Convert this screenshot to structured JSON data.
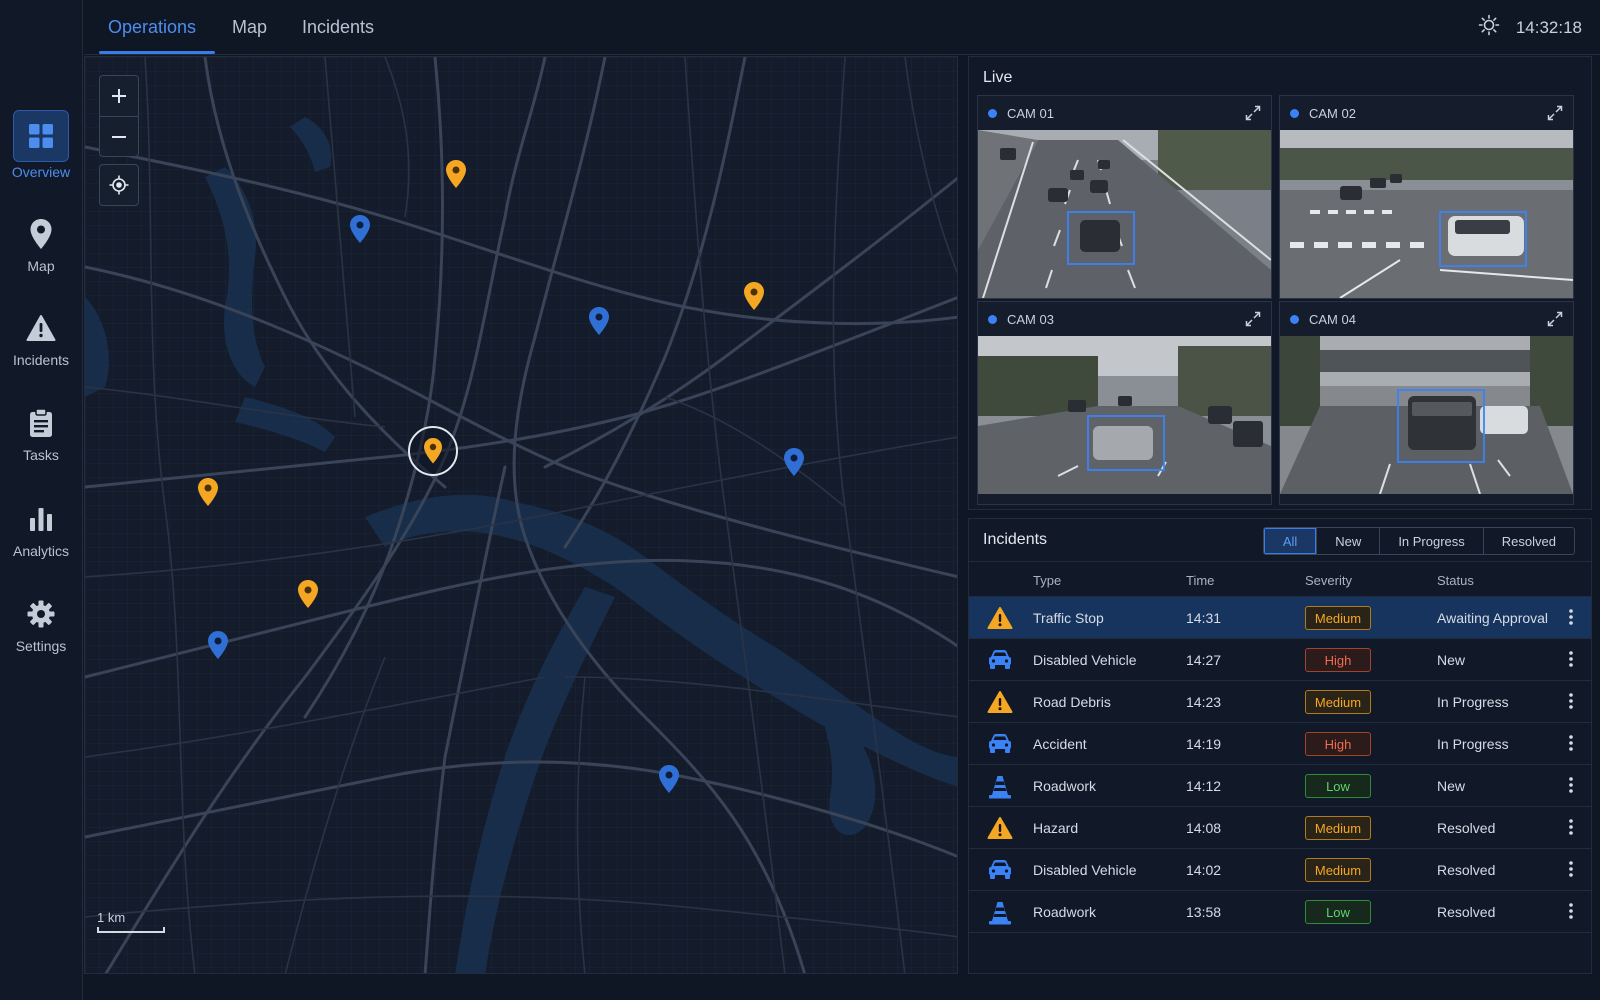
{
  "nav": {
    "items": [
      {
        "label": "Overview",
        "icon": "grid-icon",
        "active": true
      },
      {
        "label": "Map",
        "icon": "map-pin-icon"
      },
      {
        "label": "Incidents",
        "icon": "warning-icon"
      },
      {
        "label": "Tasks",
        "icon": "clipboard-icon"
      },
      {
        "label": "Analytics",
        "icon": "bar-chart-icon"
      },
      {
        "label": "Settings",
        "icon": "gear-icon"
      }
    ]
  },
  "tabs": [
    {
      "label": "Operations",
      "active": true
    },
    {
      "label": "Map"
    },
    {
      "label": "Incidents"
    }
  ],
  "header": {
    "time": "14:32:18",
    "theme_icon": "sun-icon"
  },
  "map": {
    "scale_label": "1 km",
    "controls": [
      "zoom-in",
      "zoom-out",
      "locate"
    ]
  },
  "live": {
    "title": "Live",
    "cameras": [
      {
        "label": "CAM 01"
      },
      {
        "label": "CAM 02"
      },
      {
        "label": "CAM 03"
      },
      {
        "label": "CAM 04"
      }
    ]
  },
  "incidents": {
    "title": "Incidents",
    "filters": [
      {
        "label": "All",
        "active": true
      },
      {
        "label": "New"
      },
      {
        "label": "In Progress"
      },
      {
        "label": "Resolved"
      }
    ],
    "columns": [
      "Type",
      "Time",
      "Severity",
      "Status"
    ],
    "rows": [
      {
        "icon": "warning-icon",
        "type": "Traffic Stop",
        "time": "14:31",
        "severity": "Medium",
        "status": "Awaiting Approval",
        "selected": true
      },
      {
        "icon": "car-icon",
        "type": "Disabled Vehicle",
        "time": "14:27",
        "severity": "High",
        "status": "New"
      },
      {
        "icon": "warning-icon",
        "type": "Road Debris",
        "time": "14:23",
        "severity": "Medium",
        "status": "In Progress"
      },
      {
        "icon": "car-icon",
        "type": "Accident",
        "time": "14:19",
        "severity": "High",
        "status": "In Progress"
      },
      {
        "icon": "cone-icon",
        "type": "Roadwork",
        "time": "14:12",
        "severity": "Low",
        "status": "New"
      },
      {
        "icon": "warning-icon",
        "type": "Hazard",
        "time": "14:08",
        "severity": "Medium",
        "status": "Resolved"
      },
      {
        "icon": "car-icon",
        "type": "Disabled Vehicle",
        "time": "14:02",
        "severity": "Medium",
        "status": "Resolved"
      },
      {
        "icon": "cone-icon",
        "type": "Roadwork",
        "time": "13:58",
        "severity": "Low",
        "status": "Resolved"
      }
    ]
  },
  "colors": {
    "accent": "#3b82f6",
    "pin_orange": "#f5a623",
    "pin_blue": "#2f6fd6",
    "severity_medium": "#f5a623",
    "severity_high": "#f26a4f",
    "severity_low": "#5fd36a"
  }
}
